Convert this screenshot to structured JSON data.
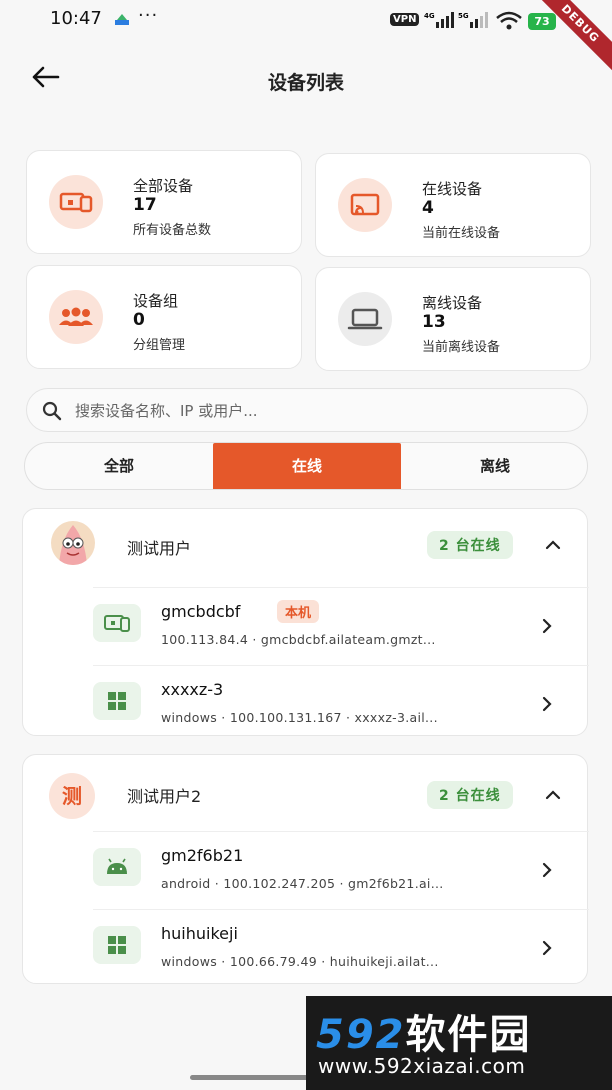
{
  "status_bar": {
    "time": "10:47",
    "dots": "···",
    "vpn": "VPN",
    "battery": "73",
    "debug": "DEBUG"
  },
  "header": {
    "title": "设备列表"
  },
  "stats": [
    {
      "label": "全部设备",
      "value": "17",
      "sub": "所有设备总数",
      "icon": "devices-icon"
    },
    {
      "label": "在线设备",
      "value": "4",
      "sub": "当前在线设备",
      "icon": "cast-icon"
    },
    {
      "label": "设备组",
      "value": "0",
      "sub": "分组管理",
      "icon": "group-icon"
    },
    {
      "label": "离线设备",
      "value": "13",
      "sub": "当前离线设备",
      "icon": "laptop-icon"
    }
  ],
  "search": {
    "placeholder": "搜索设备名称、IP 或用户..."
  },
  "tabs": {
    "all": "全部",
    "online": "在线",
    "offline": "离线",
    "selected": "online"
  },
  "groups": [
    {
      "name": "测试用户",
      "badge": "2 台在线",
      "avatar": "patrick-avatar",
      "devices": [
        {
          "name": "gmcbdcbf",
          "local_badge": "本机",
          "meta": "100.113.84.4 · gmcbdcbf.ailateam.gmzt...",
          "icon": "devices-icon"
        },
        {
          "name": "xxxxz-3",
          "meta": "windows · 100.100.131.167 · xxxxz-3.ail...",
          "icon": "windows-icon"
        }
      ]
    },
    {
      "name": "测试用户2",
      "avatar_letter": "测",
      "badge": "2 台在线",
      "devices": [
        {
          "name": "gm2f6b21",
          "meta": "android · 100.102.247.205 · gm2f6b21.ai...",
          "icon": "android-icon"
        },
        {
          "name": "huihuikeji",
          "meta": "windows · 100.66.79.49 · huihuikeji.ailat...",
          "icon": "windows-icon"
        }
      ]
    }
  ],
  "watermark": {
    "logo_num": "592",
    "logo_cn": "软件园",
    "url": "www.592xiazai.com"
  },
  "colors": {
    "accent": "#e5582a",
    "online_green": "#3b8f3b",
    "badge_green_bg": "#e6f3e6"
  }
}
